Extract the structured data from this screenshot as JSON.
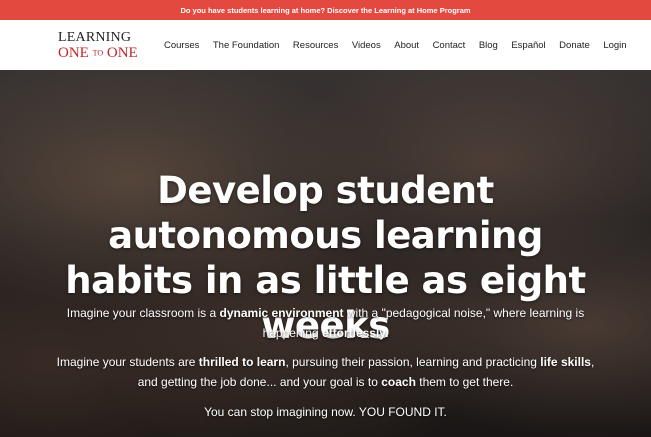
{
  "announcement": {
    "text": "Do you have students learning at home? Discover the Learning at Home Program"
  },
  "logo": {
    "line1": "LEARNING",
    "one_a": "ONE",
    "to": "TO",
    "one_b": "ONE"
  },
  "nav": [
    "Courses",
    "The Foundation",
    "Resources",
    "Videos",
    "About",
    "Contact",
    "Blog",
    "Español",
    "Donate",
    "Login"
  ],
  "hero": {
    "title": "Develop student autonomous learning habits in as little as eight weeks",
    "p1": {
      "t1": "Imagine your classroom is a ",
      "b1": "dynamic environment",
      "t2": " with a \"pedagogical noise,\" where learning is happening ",
      "b2": "effortlessly."
    },
    "p2": {
      "t1": "Imagine your students are ",
      "b1": "thrilled to learn",
      "t2": ", pursuing their passion, learning and practicing ",
      "b2": "life skills",
      "t3": ", and getting the job done... and your goal is to ",
      "b3": "coach",
      "t4": " them to get there."
    },
    "p3": "You can stop imagining now. YOU FOUND IT."
  }
}
